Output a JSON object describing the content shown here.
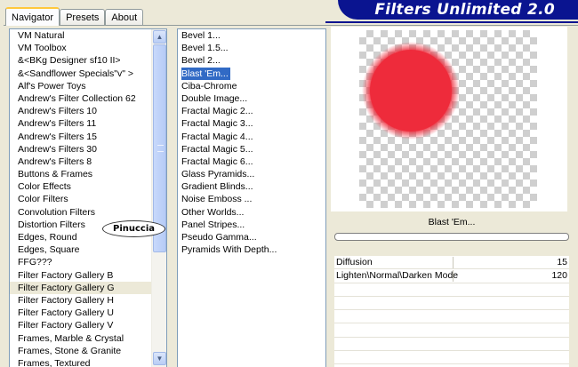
{
  "tabs": [
    "Navigator",
    "Presets",
    "About"
  ],
  "app_title": "Filters Unlimited 2.0",
  "categories": [
    "VM Natural",
    "VM Toolbox",
    "&<BKg Designer sf10 II>",
    "&<Sandflower Specials\"v\" >",
    "Alf's Power Toys",
    "Andrew's Filter Collection 62",
    "Andrew's Filters 10",
    "Andrew's Filters 11",
    "Andrew's Filters 15",
    "Andrew's Filters 30",
    "Andrew's Filters 8",
    "Buttons & Frames",
    "Color Effects",
    "Color Filters",
    "Convolution Filters",
    "Distortion Filters",
    "Edges, Round",
    "Edges, Square",
    "FFG???",
    "Filter Factory Gallery B",
    "Filter Factory Gallery G",
    "Filter Factory Gallery H",
    "Filter Factory Gallery U",
    "Filter Factory Gallery V",
    "Frames, Marble & Crystal",
    "Frames, Stone & Granite",
    "Frames, Textured"
  ],
  "filters": [
    "Bevel 1...",
    "Bevel 1.5...",
    "Bevel 2...",
    "Blast 'Em...",
    "Ciba-Chrome",
    "Double Image...",
    "Fractal Magic 2...",
    "Fractal Magic 3...",
    "Fractal Magic 4...",
    "Fractal Magic 5...",
    "Fractal Magic 6...",
    "Glass Pyramids...",
    "Gradient Blinds...",
    "Noise Emboss ...",
    "Other Worlds...",
    "Panel Stripes...",
    "Pseudo Gamma...",
    "Pyramids With Depth..."
  ],
  "watermark": "Pinuccia",
  "selected_filter_name": "Blast 'Em...",
  "progress_fraction": 0,
  "parameters": [
    {
      "label": "Diffusion",
      "value": "15"
    },
    {
      "label": "Lighten\\Normal\\Darken Mode",
      "value": "120"
    }
  ],
  "colors": {
    "accent": "#0a1490",
    "selection": "#316ac5",
    "preview_blob": "#ee2b3b"
  }
}
